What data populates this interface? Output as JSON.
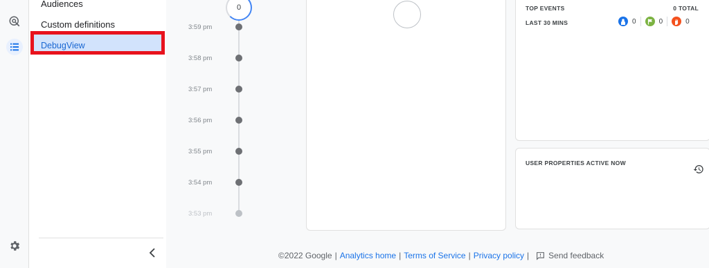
{
  "nav": {
    "items": [
      {
        "label": "Audiences"
      },
      {
        "label": "Custom definitions"
      },
      {
        "label": "DebugView",
        "selected": true
      }
    ]
  },
  "timeline": {
    "top_count": "0",
    "times": [
      "3:59 pm",
      "3:58 pm",
      "3:57 pm",
      "3:56 pm",
      "3:55 pm",
      "3:54 pm",
      "3:53 pm"
    ]
  },
  "top_events": {
    "title": "TOP EVENTS",
    "total": "0 TOTAL",
    "range": "LAST 30 MINS",
    "counts": [
      {
        "icon": "person-icon",
        "color": "#1a73e8",
        "value": "0"
      },
      {
        "icon": "flag-icon",
        "color": "#7cb342",
        "value": "0"
      },
      {
        "icon": "hand-icon",
        "color": "#f4511e",
        "value": "0"
      }
    ]
  },
  "user_properties": {
    "title": "USER PROPERTIES ACTIVE NOW"
  },
  "footer": {
    "copyright": "©2022 Google",
    "analytics_home": "Analytics home",
    "terms": "Terms of Service",
    "privacy": "Privacy policy",
    "feedback": "Send feedback",
    "separator": "|"
  },
  "colors": {
    "highlight_border": "#e8121d",
    "selected_bg": "#d2e3fc",
    "link": "#1a73e8"
  }
}
